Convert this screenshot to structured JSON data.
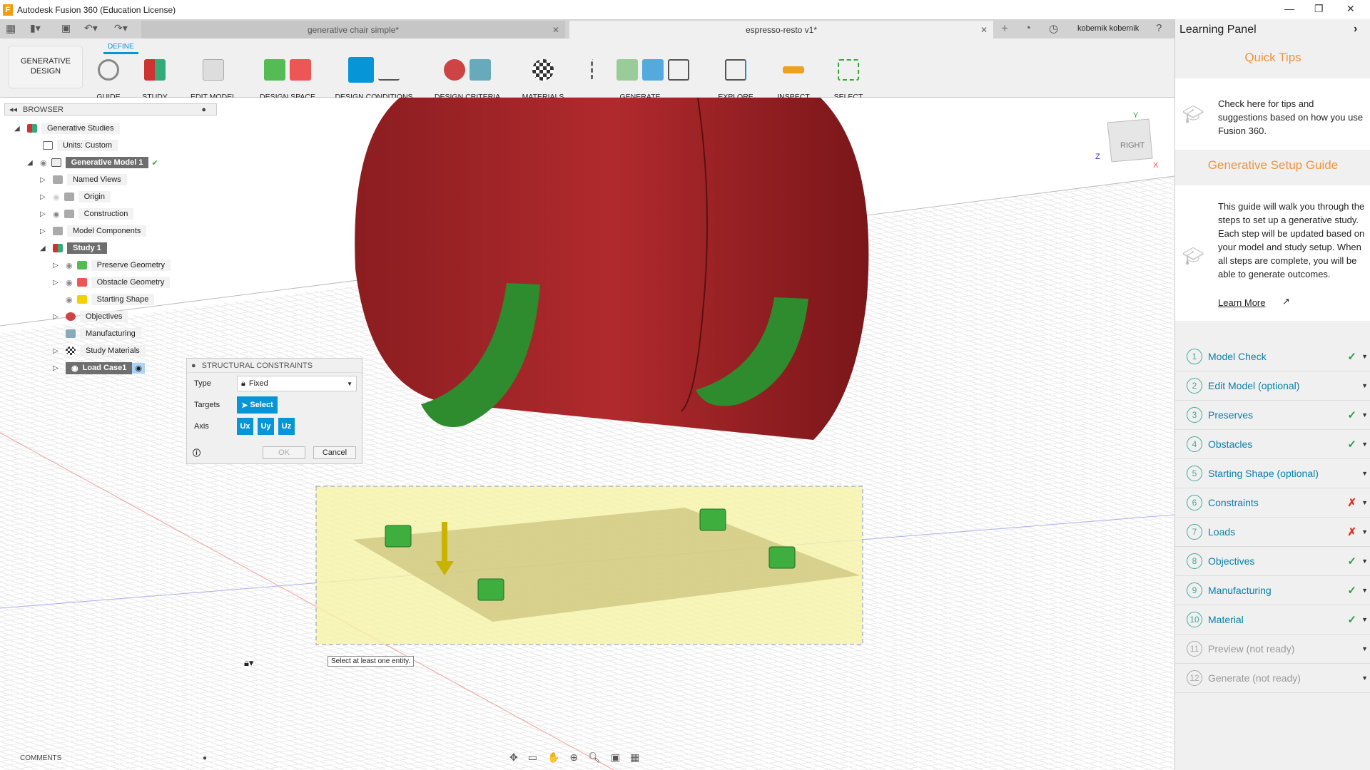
{
  "window": {
    "title": "Autodesk Fusion 360 (Education License)",
    "logo": "F"
  },
  "tabs": [
    {
      "label": "generative chair simple*"
    },
    {
      "label": "espresso-resto v1*"
    }
  ],
  "user": "kobernik kobernik",
  "toolbar": {
    "define_tab": "DEFINE",
    "workspace": "GENERATIVE DESIGN",
    "groups": [
      {
        "label": "GUIDE"
      },
      {
        "label": "STUDY"
      },
      {
        "label": "EDIT MODEL"
      },
      {
        "label": "DESIGN SPACE"
      },
      {
        "label": "DESIGN CONDITIONS"
      },
      {
        "label": "DESIGN CRITERIA"
      },
      {
        "label": "MATERIALS"
      },
      {
        "label": "GENERATE"
      },
      {
        "label": "EXPLORE"
      },
      {
        "label": "INSPECT"
      },
      {
        "label": "SELECT"
      }
    ]
  },
  "browser": {
    "title": "BROWSER",
    "items": [
      "Generative Studies",
      "Units: Custom",
      "Generative Model 1",
      "Named Views",
      "Origin",
      "Construction",
      "Model Components",
      "Study 1",
      "Preserve Geometry",
      "Obstacle Geometry",
      "Starting Shape",
      "Objectives",
      "Manufacturing",
      "Study Materials",
      "Load Case1"
    ]
  },
  "dialog": {
    "title": "STRUCTURAL CONSTRAINTS",
    "type_label": "Type",
    "type_value": "Fixed",
    "targets_label": "Targets",
    "select_label": "Select",
    "axis_label": "Axis",
    "axes": [
      "Ux",
      "Uy",
      "Uz"
    ],
    "ok": "OK",
    "cancel": "Cancel"
  },
  "tooltip": "Select at least one entity.",
  "viewcube": {
    "face": "RIGHT",
    "x": "X",
    "y": "Y",
    "z": "Z"
  },
  "comments": "COMMENTS",
  "learning_panel": {
    "title": "Learning Panel",
    "quick_tips_title": "Quick Tips",
    "quick_tips_text": "Check here for tips and suggestions based on how you use Fusion 360.",
    "guide_title": "Generative Setup Guide",
    "guide_text": "This guide will walk you through the steps to set up a generative study. Each step will be updated based on your model and study setup. When all steps are complete, you will be able to generate outcomes.",
    "learn_more": "Learn More",
    "steps": [
      {
        "num": "1",
        "label": "Model Check",
        "status": "✓"
      },
      {
        "num": "2",
        "label": "Edit Model (optional)",
        "status": ""
      },
      {
        "num": "3",
        "label": "Preserves",
        "status": "✓"
      },
      {
        "num": "4",
        "label": "Obstacles",
        "status": "✓"
      },
      {
        "num": "5",
        "label": "Starting Shape (optional)",
        "status": ""
      },
      {
        "num": "6",
        "label": "Constraints",
        "status": "✗"
      },
      {
        "num": "7",
        "label": "Loads",
        "status": "✗"
      },
      {
        "num": "8",
        "label": "Objectives",
        "status": "✓"
      },
      {
        "num": "9",
        "label": "Manufacturing",
        "status": "✓"
      },
      {
        "num": "10",
        "label": "Material",
        "status": "✓"
      },
      {
        "num": "11",
        "label": "Preview (not ready)",
        "status": ""
      },
      {
        "num": "12",
        "label": "Generate (not ready)",
        "status": ""
      }
    ]
  },
  "colors": {
    "accent": "#0696d7",
    "orange": "#f0923b",
    "ok": "#2e9e3e",
    "error": "#e0301e"
  }
}
